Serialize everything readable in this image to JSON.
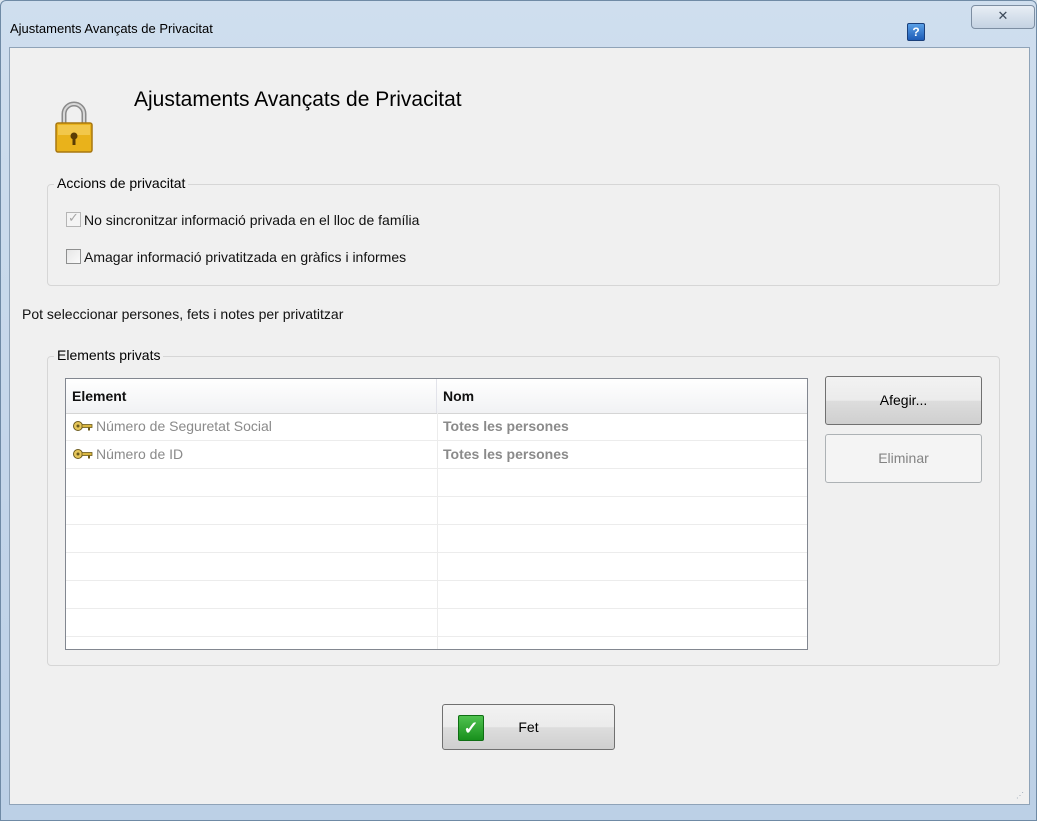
{
  "window": {
    "title": "Ajustaments Avançats de Privacitat",
    "help_label": "?",
    "close_label": "✕"
  },
  "header": {
    "title": "Ajustaments Avançats de Privacitat"
  },
  "privacy_actions": {
    "legend": "Accions de privacitat",
    "items": [
      {
        "label": "No sincronitzar informació privada en el lloc de família",
        "checked": true,
        "disabled": true
      },
      {
        "label": "Amagar informació privatitzada en gràfics i informes",
        "checked": false,
        "disabled": false
      }
    ]
  },
  "info_text": "Pot seleccionar persones, fets i notes per privatitzar",
  "private_elements": {
    "legend": "Elements privats",
    "columns": [
      "Element",
      "Nom"
    ],
    "rows": [
      {
        "element": "Número de Seguretat Social",
        "name": "Totes les persones",
        "icon": "key-icon"
      },
      {
        "element": "Número de ID",
        "name": "Totes les persones",
        "icon": "key-icon"
      }
    ],
    "buttons": {
      "add": "Afegir...",
      "remove": "Eliminar"
    }
  },
  "footer": {
    "done_label": "Fet"
  },
  "colors": {
    "done_check": "#18901d",
    "help_icon": "#1d5cb6"
  }
}
